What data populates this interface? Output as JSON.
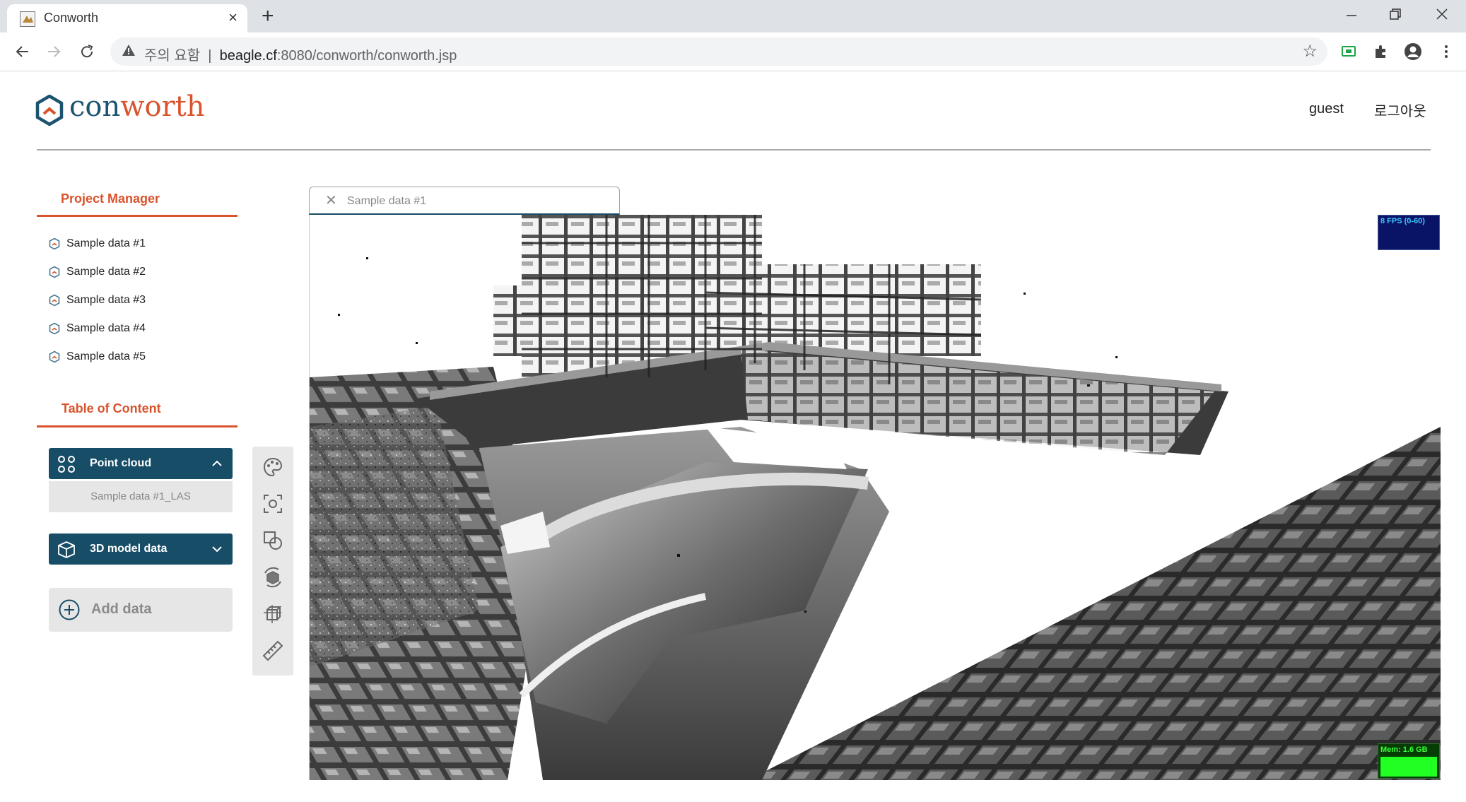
{
  "browser": {
    "tab_title": "Conworth",
    "new_tab_label": "+",
    "tab_close_label": "×",
    "security_label": "주의 요함",
    "url_host": "beagle.cf",
    "url_rest": ":8080/conworth/conworth.jsp",
    "window_controls": [
      "minimize-icon",
      "restore-icon",
      "close-icon"
    ]
  },
  "header": {
    "brand_a": "con",
    "brand_b": "worth",
    "user": "guest",
    "logout": "로그아웃"
  },
  "project_manager": {
    "title": "Project Manager",
    "items": [
      "Sample data #1",
      "Sample data #2",
      "Sample data #3",
      "Sample data #4",
      "Sample data #5"
    ]
  },
  "toc": {
    "title": "Table of Content",
    "point_cloud": {
      "label": "Point cloud",
      "items": [
        "Sample data #1_LAS"
      ]
    },
    "model_3d": {
      "label": "3D model data"
    },
    "add_data": "Add data"
  },
  "viewer": {
    "tab_label": "Sample data #1",
    "tab_close": "✕",
    "fps": "8 FPS (0-60)",
    "mem": "Mem: 1.6 GB"
  },
  "toolbar": {
    "tools": [
      "palette-icon",
      "focus-icon",
      "shapes-icon",
      "rotate-cube-icon",
      "bounding-box-icon",
      "ruler-icon"
    ]
  },
  "colors": {
    "brand_dark": "#184d68",
    "brand_accent": "#d9532c",
    "fps_text": "#41c9ff",
    "mem_bar": "#22ff22"
  }
}
